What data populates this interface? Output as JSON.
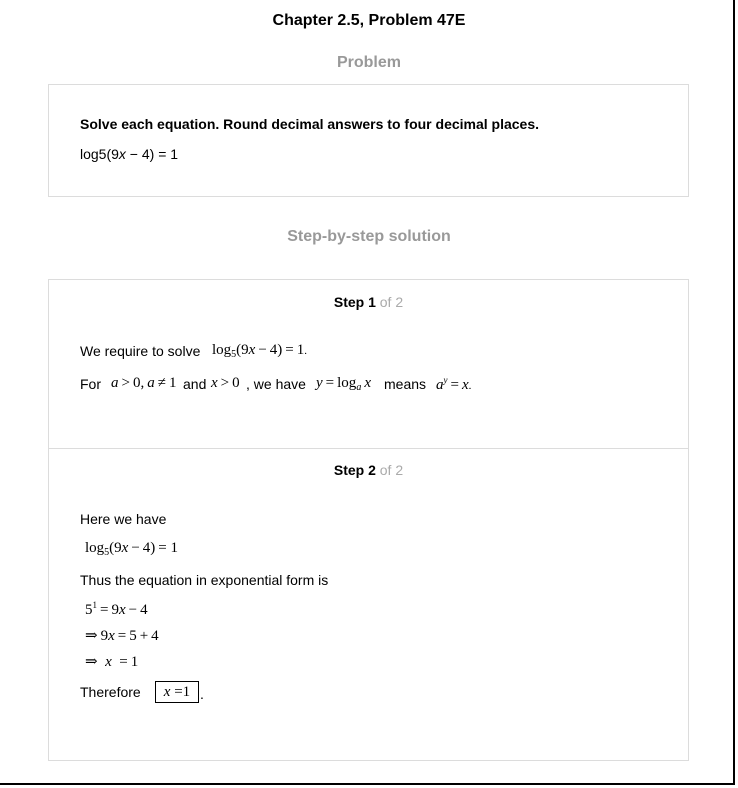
{
  "header": {
    "title": "Chapter 2.5, Problem 47E"
  },
  "problem": {
    "heading": "Problem",
    "prompt": "Solve each equation. Round decimal answers to four decimal places.",
    "equation_parts": [
      "log5(9",
      "x",
      " − 4) = 1"
    ]
  },
  "solution": {
    "heading": "Step-by-step solution",
    "steps": [
      {
        "label": "Step 1",
        "of": " of 2",
        "line1_text": "We require to solve",
        "line2_for": "For",
        "line2_and": "and",
        "line2_we_have": ", we have",
        "line2_means": "means"
      },
      {
        "label": "Step 2",
        "of": " of 2",
        "here_text": "Here we have",
        "thus_text": "Thus the equation in exponential form is",
        "therefore_text": "Therefore",
        "answer_var": "x",
        "answer_eq": " =1"
      }
    ]
  }
}
